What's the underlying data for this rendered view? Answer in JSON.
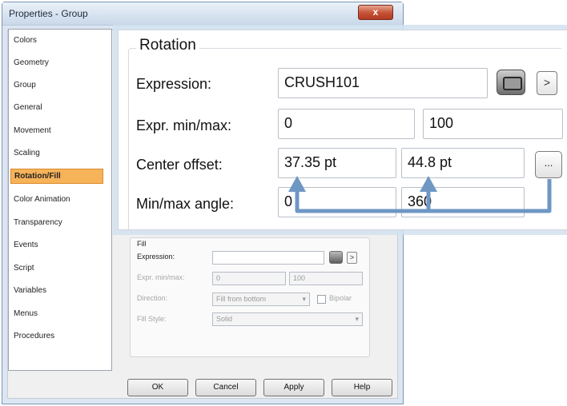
{
  "window": {
    "title": "Properties - Group",
    "close_symbol": "x"
  },
  "categories": [
    "Colors",
    "Geometry",
    "Group",
    "General",
    "Movement",
    "Scaling",
    "Rotation/Fill",
    "Color Animation",
    "Transparency",
    "Events",
    "Script",
    "Variables",
    "Menus",
    "Procedures"
  ],
  "selected_category": "Rotation/Fill",
  "rotation": {
    "title": "Rotation",
    "expression_label": "Expression:",
    "expression_value": "CRUSH101",
    "expr_minmax_label": "Expr. min/max:",
    "expr_min": "0",
    "expr_max": "100",
    "center_offset_label": "Center offset:",
    "center_x": "37.35 pt",
    "center_y": "44.8 pt",
    "minmax_angle_label": "Min/max angle:",
    "angle_min": "0",
    "angle_max": "360",
    "browse_symbol": ">",
    "dots_label": "..."
  },
  "fill": {
    "title": "Fill",
    "expression_label": "Expression:",
    "expression_value": "",
    "expr_minmax_label": "Expr. min/max:",
    "expr_min": "0",
    "expr_max": "100",
    "direction_label": "Direction:",
    "direction_value": "Fill from bottom",
    "bipolar_label": "Bipolar",
    "fill_style_label": "Fill Style:",
    "fill_style_value": "Solid",
    "browse_symbol": ">"
  },
  "buttons": {
    "ok": "OK",
    "cancel": "Cancel",
    "apply": "Apply",
    "help": "Help"
  },
  "colors": {
    "selection": "#f7b35a",
    "arrow": "#6f97c4"
  }
}
